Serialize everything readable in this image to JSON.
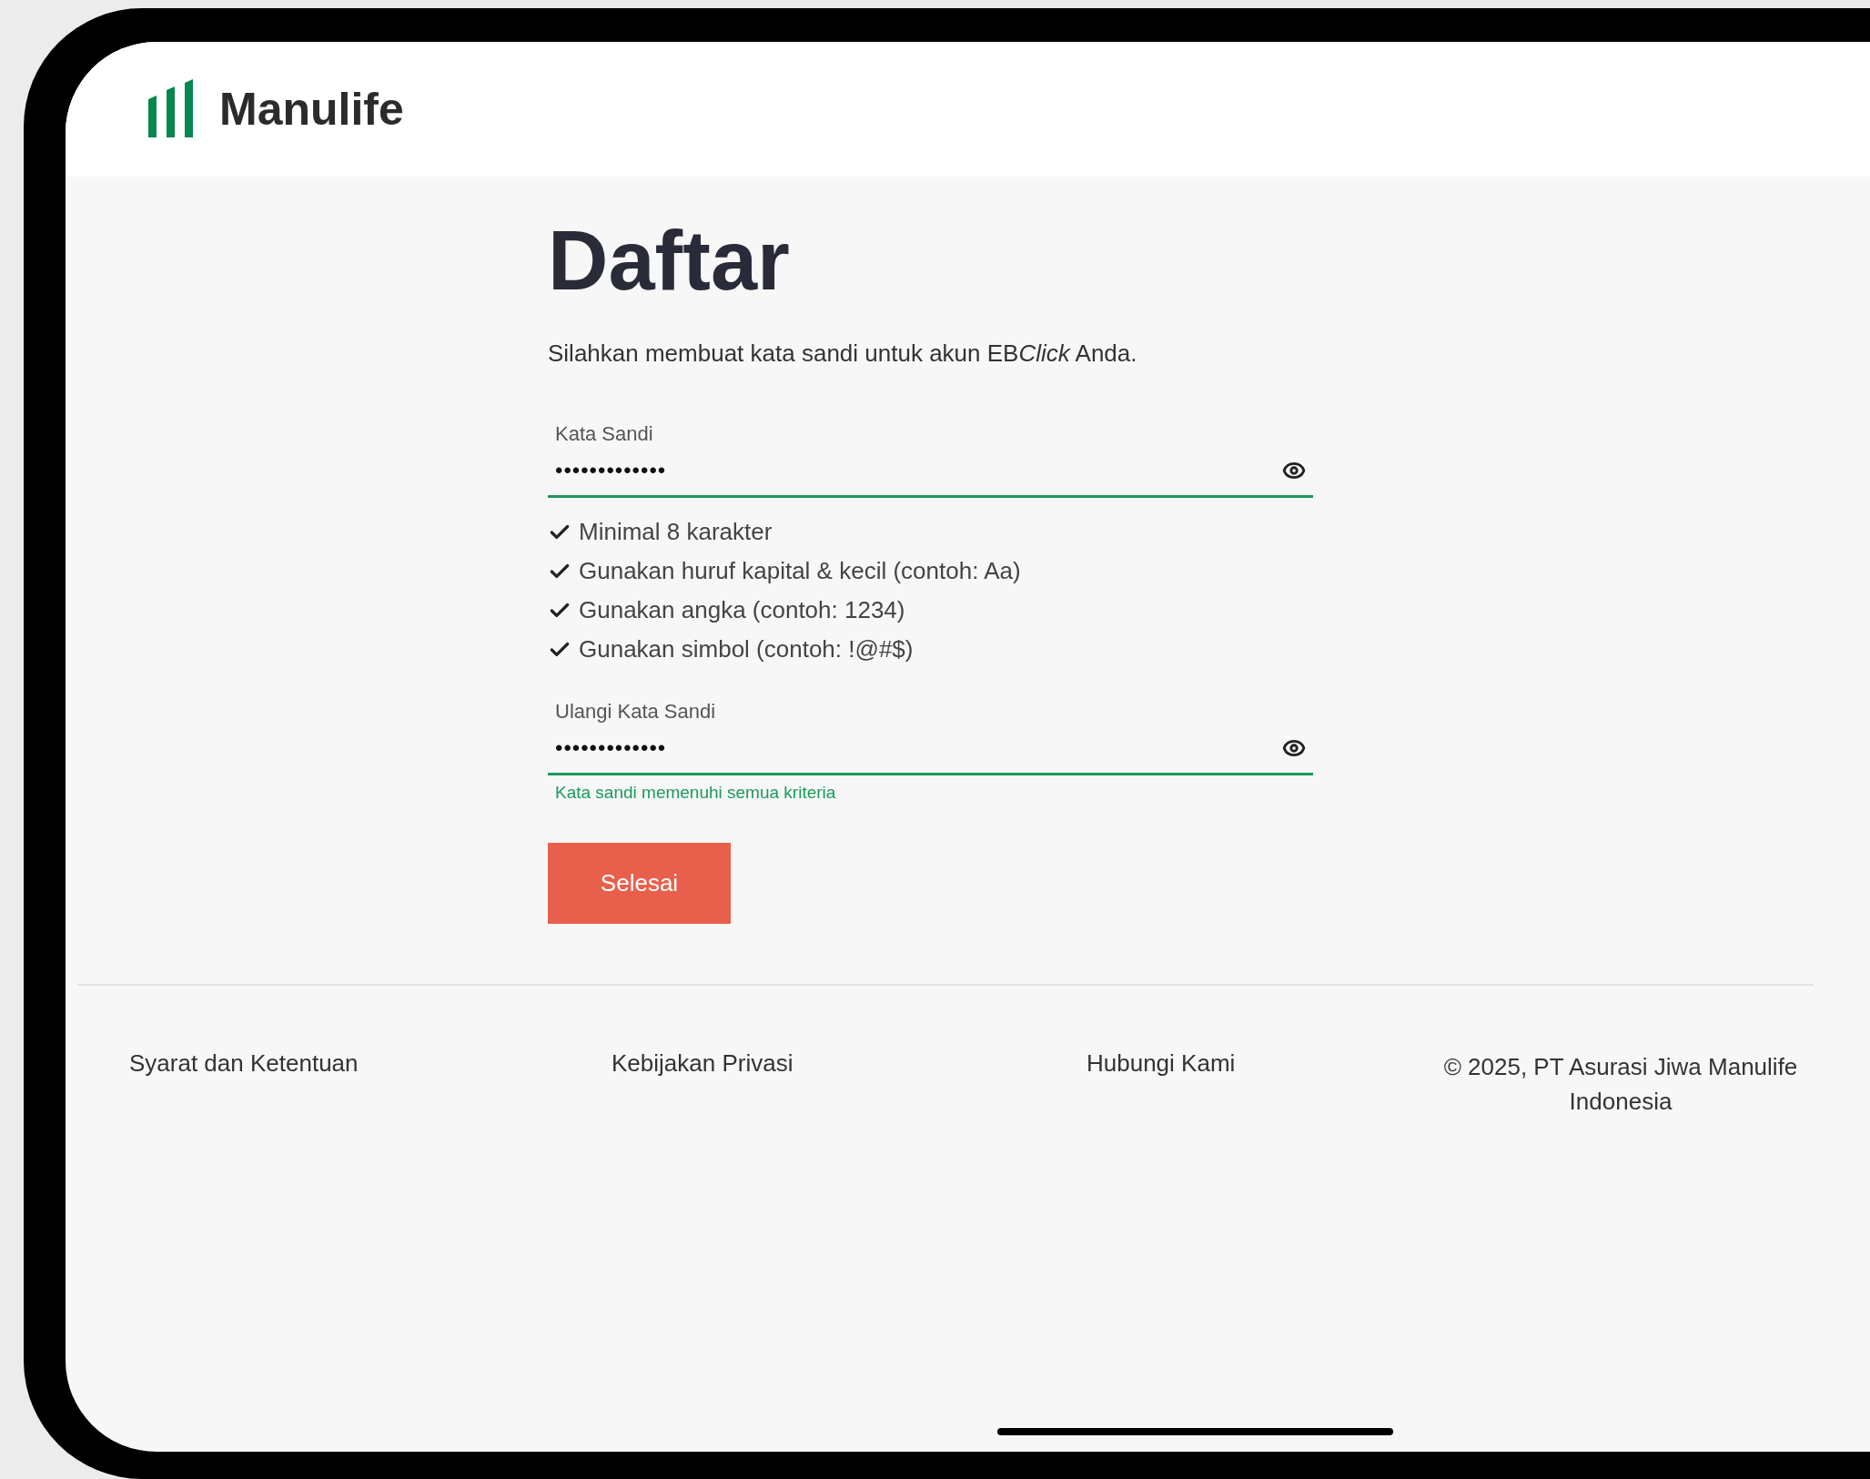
{
  "header": {
    "logo_text": "Manulife"
  },
  "form": {
    "title": "Daftar",
    "intro": {
      "before": "Silahkan membuat kata sandi untuk akun EB",
      "italic": "Click",
      "after": " Anda."
    },
    "fields": [
      {
        "label": "Kata Sandi",
        "value": "•••••••••••••",
        "valid": true
      },
      {
        "label": "Ulangi Kata Sandi",
        "value": "•••••••••••••",
        "valid": true,
        "helper": "Kata sandi memenuhi semua kriteria"
      }
    ],
    "requirements": [
      {
        "text": "Minimal 8 karakter",
        "met": true
      },
      {
        "text": "Gunakan huruf kapital & kecil (contoh: Aa)",
        "met": true
      },
      {
        "text": "Gunakan angka (contoh: 1234)",
        "met": true
      },
      {
        "text": "Gunakan simbol (contoh: !@#$)",
        "met": true
      }
    ],
    "submit": "Selesai"
  },
  "footer": {
    "links": [
      "Syarat dan Ketentuan",
      "Kebijakan Privasi",
      "Hubungi Kami"
    ],
    "copyright": "© 2025, PT Asurasi Jiwa Manulife Indonesia"
  }
}
